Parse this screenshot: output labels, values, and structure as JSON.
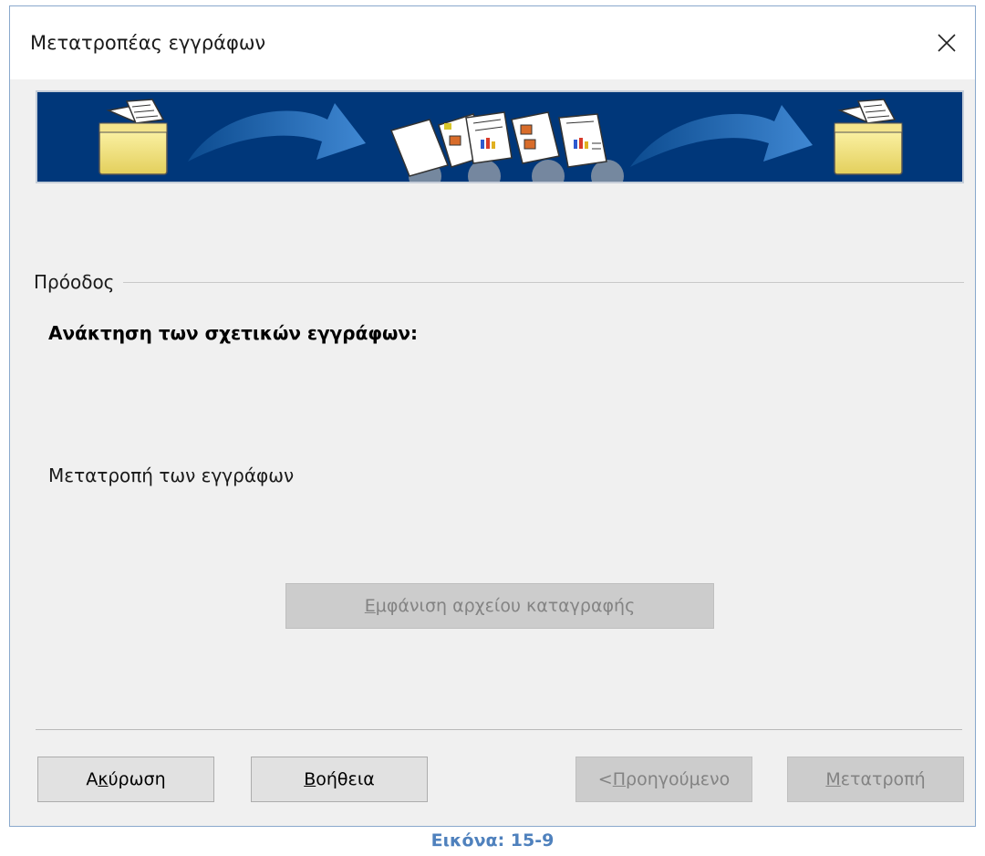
{
  "window": {
    "title": "Μετατροπέας εγγράφων"
  },
  "progress": {
    "section_label": "Πρόοδος",
    "step_retrieve": "Ανάκτηση των σχετικών εγγράφων:",
    "step_convert": "Μετατροπή των εγγράφων"
  },
  "log_button": {
    "ul": "Ε",
    "rest": "μφάνιση αρχείου καταγραφής"
  },
  "footer": {
    "cancel": {
      "pre": "Α",
      "ul": "κ",
      "rest": "ύρωση"
    },
    "help": {
      "ul": "Β",
      "rest": "οήθεια"
    },
    "back": {
      "pre": "<",
      "ul": "Π",
      "rest": "ροηγούμενο"
    },
    "convert": {
      "ul": "Μ",
      "rest": "ετατροπή"
    }
  },
  "caption": "Εικόνα: 15-9",
  "icons": [
    "close-icon",
    "folder-icon",
    "arrow-icon",
    "document-icon",
    "gears-icon"
  ],
  "colors": {
    "banner_bg": "#00377a",
    "caption": "#4f81bd",
    "dialog_bg": "#f0f0f0"
  }
}
